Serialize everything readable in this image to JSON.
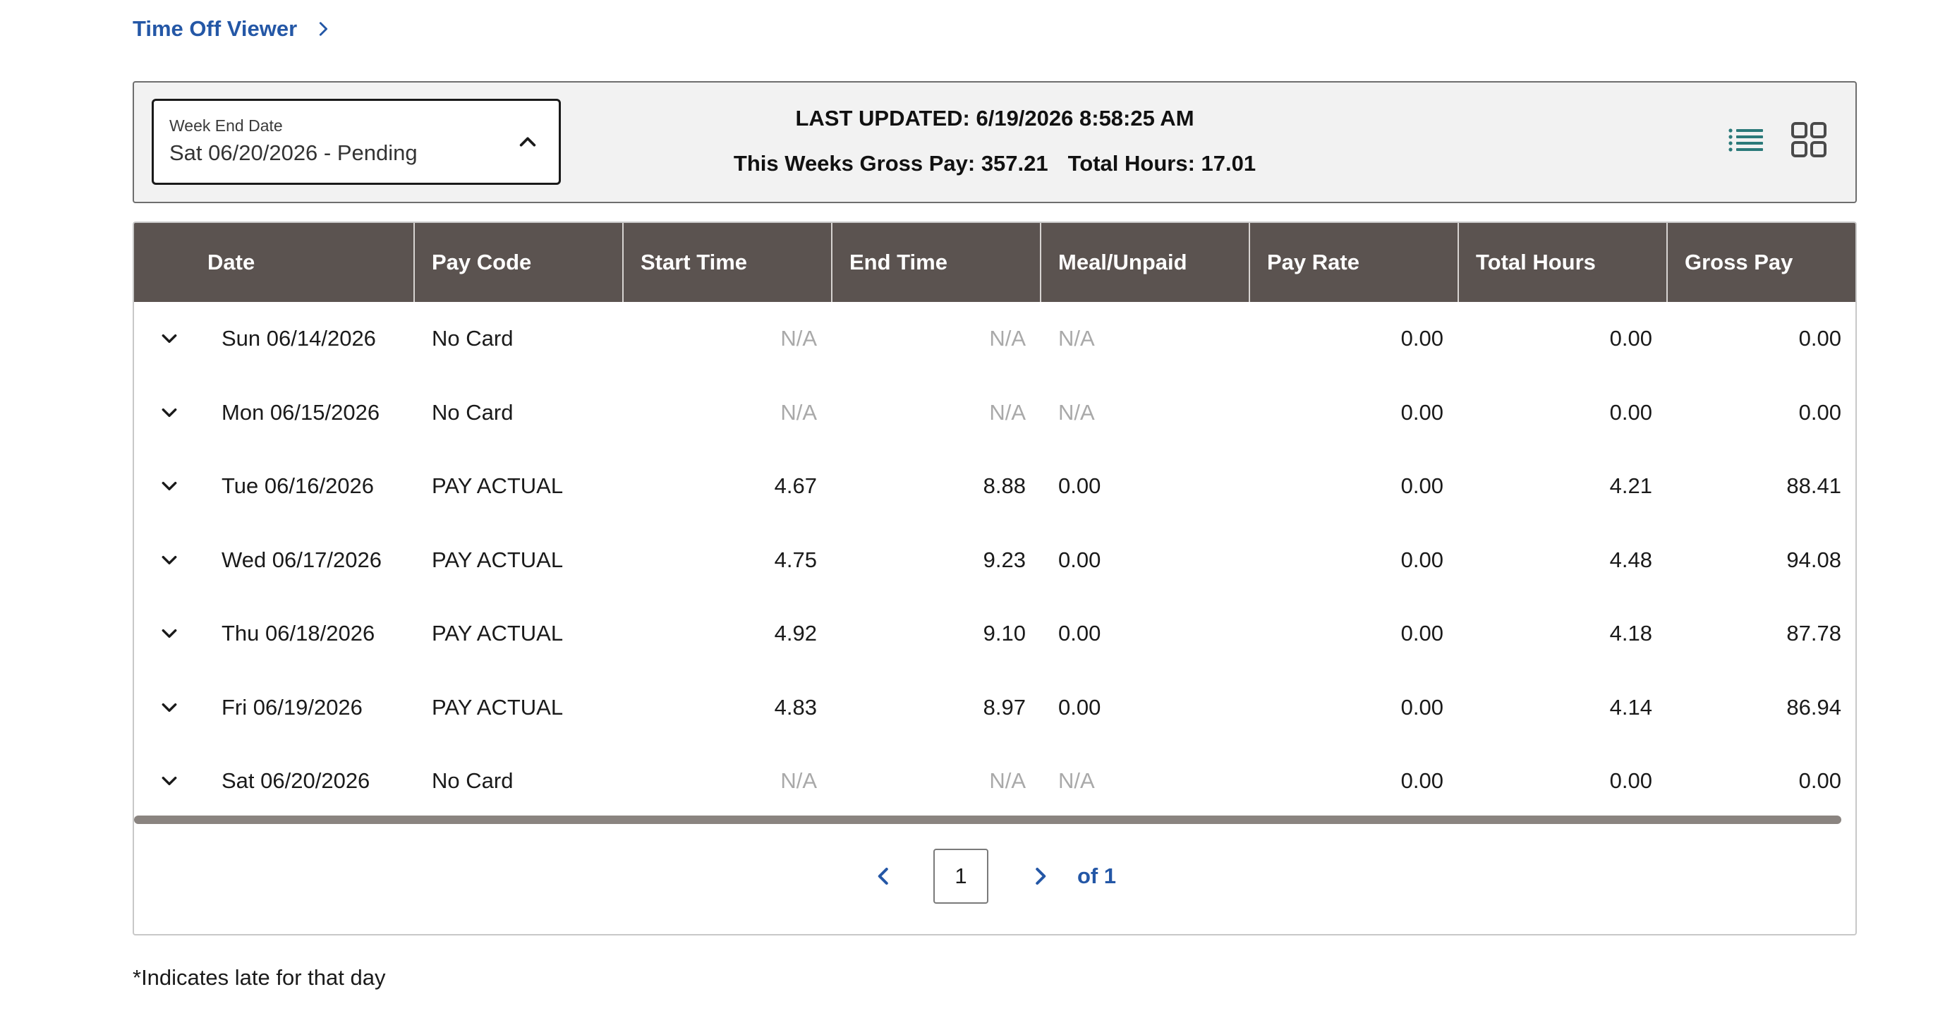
{
  "breadcrumb": {
    "label": "Time Off Viewer",
    "icon": "chevron-right-icon"
  },
  "week_select": {
    "label": "Week End Date",
    "value": "Sat 06/20/2026 - Pending",
    "icon": "chevron-up-icon"
  },
  "summary": {
    "last_updated": "LAST UPDATED: 6/19/2026 8:58:25 AM",
    "gross_pay": "This Weeks Gross Pay: 357.21",
    "total_hours": "Total Hours: 17.01"
  },
  "view_toggle": {
    "list_icon": "list-view-icon",
    "grid_icon": "grid-view-icon",
    "accent": "#2b7a7a"
  },
  "table": {
    "headers": [
      "Date",
      "Pay Code",
      "Start Time",
      "End Time",
      "Meal/Unpaid",
      "Pay Rate",
      "Total Hours",
      "Gross Pay"
    ],
    "rows": [
      {
        "date": "Sun 06/14/2026",
        "pay_code": "No Card",
        "start": "N/A",
        "end": "N/A",
        "meal": "N/A",
        "rate": "0.00",
        "hours": "0.00",
        "gross": "0.00"
      },
      {
        "date": "Mon 06/15/2026",
        "pay_code": "No Card",
        "start": "N/A",
        "end": "N/A",
        "meal": "N/A",
        "rate": "0.00",
        "hours": "0.00",
        "gross": "0.00"
      },
      {
        "date": "Tue 06/16/2026",
        "pay_code": "PAY ACTUAL",
        "start": "4.67",
        "end": "8.88",
        "meal": "0.00",
        "rate": "0.00",
        "hours": "4.21",
        "gross": "88.41"
      },
      {
        "date": "Wed 06/17/2026",
        "pay_code": "PAY ACTUAL",
        "start": "4.75",
        "end": "9.23",
        "meal": "0.00",
        "rate": "0.00",
        "hours": "4.48",
        "gross": "94.08"
      },
      {
        "date": "Thu 06/18/2026",
        "pay_code": "PAY ACTUAL",
        "start": "4.92",
        "end": "9.10",
        "meal": "0.00",
        "rate": "0.00",
        "hours": "4.18",
        "gross": "87.78"
      },
      {
        "date": "Fri 06/19/2026",
        "pay_code": "PAY ACTUAL",
        "start": "4.83",
        "end": "8.97",
        "meal": "0.00",
        "rate": "0.00",
        "hours": "4.14",
        "gross": "86.94"
      },
      {
        "date": "Sat 06/20/2026",
        "pay_code": "No Card",
        "start": "N/A",
        "end": "N/A",
        "meal": "N/A",
        "rate": "0.00",
        "hours": "0.00",
        "gross": "0.00"
      }
    ]
  },
  "pagination": {
    "current_page": "1",
    "of_label": "of 1"
  },
  "footnote": "*Indicates late for that day",
  "colors": {
    "header_bg": "#5b5350",
    "link": "#2457a6",
    "na_text": "#a9a9a9"
  }
}
